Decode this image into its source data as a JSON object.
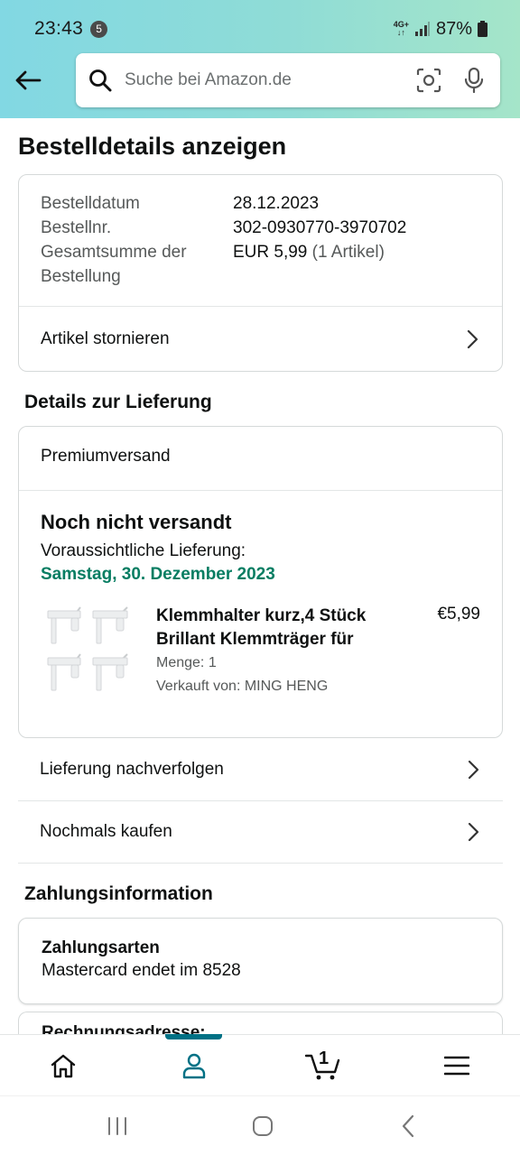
{
  "status_bar": {
    "time": "23:43",
    "notification_count": "5",
    "network_type": "4G+",
    "battery": "87%"
  },
  "search": {
    "placeholder": "Suche bei Amazon.de"
  },
  "page": {
    "title": "Bestelldetails anzeigen"
  },
  "order_summary": {
    "date_label": "Bestelldatum",
    "date_value": "28.12.2023",
    "number_label": "Bestellnr.",
    "number_value": "302-0930770-3970702",
    "total_label_line1": "Gesamtsumme der",
    "total_label_line2": "Bestellung",
    "total_value": "EUR 5,99",
    "total_items": "(1 Artikel)",
    "cancel_label": "Artikel stornieren"
  },
  "delivery": {
    "section_title": "Details zur Lieferung",
    "shipping_method": "Premiumversand",
    "status": "Noch nicht versandt",
    "eta_label": "Voraussichtliche Lieferung:",
    "eta_date": "Samstag, 30. Dezember 2023",
    "eta_color": "#067D62",
    "item": {
      "title_line1": "Klemmhalter kurz,4 Stück",
      "title_line2": "Brillant Klemmträger für",
      "price": "€5,99",
      "quantity": "Menge: 1",
      "seller": "Verkauft von: MING HENG"
    },
    "track_label": "Lieferung nachverfolgen",
    "buy_again_label": "Nochmals kaufen"
  },
  "payment": {
    "section_title": "Zahlungsinformation",
    "methods_title": "Zahlungsarten",
    "methods_value": "Mastercard  endet im 8528",
    "billing_title": "Rechnungsadresse:"
  },
  "bottom_nav": {
    "cart_count": "1",
    "active": "account",
    "accent": "#007185"
  },
  "icons": [
    "back-arrow-icon",
    "search-icon",
    "camera-scan-icon",
    "microphone-icon",
    "chevron-right-icon",
    "home-icon",
    "account-icon",
    "cart-icon",
    "menu-icon",
    "recents-icon",
    "home-circle-icon",
    "back-chevron-icon"
  ]
}
